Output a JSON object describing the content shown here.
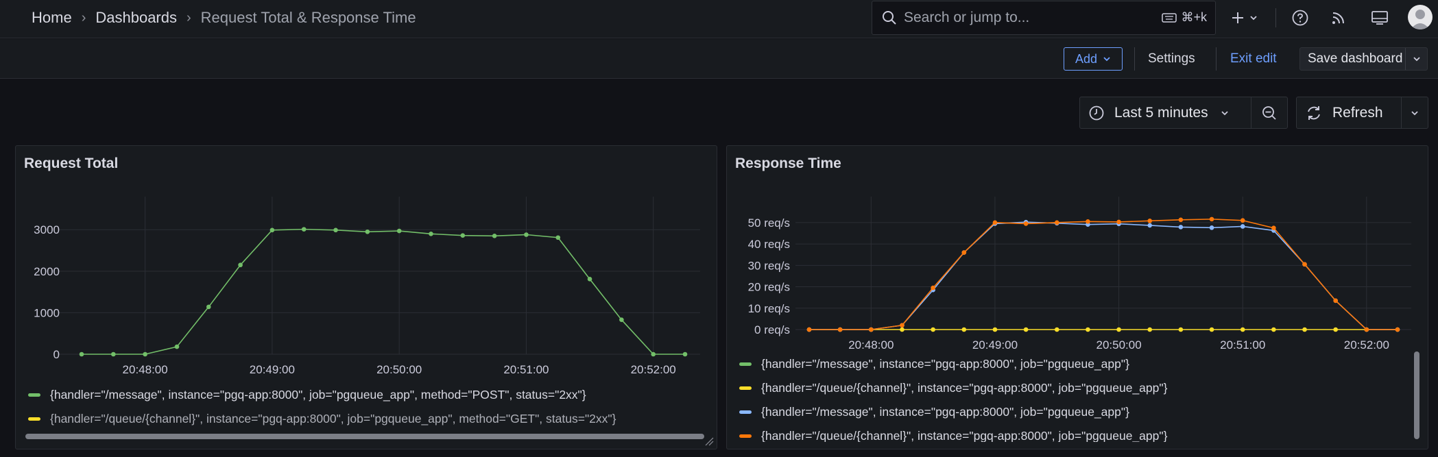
{
  "breadcrumb": [
    "Home",
    "Dashboards",
    "Request Total & Response Time"
  ],
  "breadcrumb_sep": "›",
  "search": {
    "placeholder": "Search or jump to...",
    "shortcut": "⌘+k"
  },
  "toolbar": {
    "add_label": "Add",
    "settings_label": "Settings",
    "exit_label": "Exit edit",
    "save_label": "Save dashboard"
  },
  "time_picker": {
    "range": "Last 5 minutes",
    "refresh_label": "Refresh"
  },
  "colors": {
    "green": "#73bf69",
    "yellow": "#fade2a",
    "blue": "#8ab8ff",
    "orange": "#ff780a",
    "accent": "#6e9fff"
  },
  "panels": {
    "request_total": {
      "title": "Request Total",
      "legend": [
        {
          "label": "{handler=\"/message\", instance=\"pgq-app:8000\", job=\"pgqueue_app\", method=\"POST\", status=\"2xx\"}",
          "color": "#73bf69"
        },
        {
          "label": "{handler=\"/queue/{channel}\", instance=\"pgq-app:8000\", job=\"pgqueue_app\", method=\"GET\", status=\"2xx\"}",
          "color": "#fade2a"
        }
      ]
    },
    "response_time": {
      "title": "Response Time",
      "legend": [
        {
          "label": "{handler=\"/message\", instance=\"pgq-app:8000\", job=\"pgqueue_app\"}",
          "color": "#73bf69"
        },
        {
          "label": "{handler=\"/queue/{channel}\", instance=\"pgq-app:8000\", job=\"pgqueue_app\"}",
          "color": "#fade2a"
        },
        {
          "label": "{handler=\"/message\", instance=\"pgq-app:8000\", job=\"pgqueue_app\"}",
          "color": "#8ab8ff"
        },
        {
          "label": "{handler=\"/queue/{channel}\", instance=\"pgq-app:8000\", job=\"pgqueue_app\"}",
          "color": "#ff780a"
        }
      ]
    }
  },
  "chart_data": [
    {
      "type": "line",
      "title": "Request Total",
      "x": [
        "20:47:30",
        "20:47:45",
        "20:48:00",
        "20:48:15",
        "20:48:30",
        "20:48:45",
        "20:49:00",
        "20:49:15",
        "20:49:30",
        "20:49:45",
        "20:50:00",
        "20:50:15",
        "20:50:30",
        "20:50:45",
        "20:51:00",
        "20:51:15",
        "20:51:30",
        "20:51:45",
        "20:52:00",
        "20:52:15"
      ],
      "xticks": [
        "20:48:00",
        "20:49:00",
        "20:50:00",
        "20:51:00",
        "20:52:00"
      ],
      "yticks": [
        "0",
        "1000",
        "2000",
        "3000"
      ],
      "ylim": [
        0,
        3400
      ],
      "grid": true,
      "series": [
        {
          "name": "{handler=\"/message\", instance=\"pgq-app:8000\", job=\"pgqueue_app\", method=\"POST\", status=\"2xx\"}",
          "color": "#73bf69",
          "values": [
            0,
            0,
            0,
            180,
            1140,
            2150,
            2990,
            3010,
            2990,
            2950,
            2970,
            2900,
            2860,
            2850,
            2880,
            2810,
            1810,
            830,
            0,
            0
          ]
        }
      ]
    },
    {
      "type": "line",
      "title": "Response Time",
      "x": [
        "20:47:30",
        "20:47:45",
        "20:48:00",
        "20:48:15",
        "20:48:30",
        "20:48:45",
        "20:49:00",
        "20:49:15",
        "20:49:30",
        "20:49:45",
        "20:50:00",
        "20:50:15",
        "20:50:30",
        "20:50:45",
        "20:51:00",
        "20:51:15",
        "20:51:30",
        "20:51:45",
        "20:52:00",
        "20:52:15"
      ],
      "xticks": [
        "20:48:00",
        "20:49:00",
        "20:50:00",
        "20:51:00",
        "20:52:00"
      ],
      "yticks": [
        "0 req/s",
        "10 req/s",
        "20 req/s",
        "30 req/s",
        "40 req/s",
        "50 req/s"
      ],
      "ylim": [
        0,
        57
      ],
      "grid": true,
      "series": [
        {
          "name": "{handler=\"/queue/{channel}\", instance=\"pgq-app:8000\", job=\"pgqueue_app\"}",
          "color": "#fade2a",
          "values": [
            0,
            0,
            0,
            0,
            0,
            0,
            0,
            0,
            0,
            0,
            0,
            0,
            0,
            0,
            0,
            0,
            0,
            0,
            0,
            0
          ]
        },
        {
          "name": "{handler=\"/message\", instance=\"pgq-app:8000\", job=\"pgqueue_app\"}",
          "color": "#8ab8ff",
          "values": [
            0,
            0,
            0,
            2,
            18.5,
            36,
            49.5,
            50.2,
            49.7,
            49.1,
            49.4,
            48.7,
            47.9,
            47.6,
            48.2,
            46.3,
            30.5,
            13.5,
            0,
            0
          ]
        },
        {
          "name": "{handler=\"/queue/{channel}\", instance=\"pgq-app:8000\", job=\"pgqueue_app\"}",
          "color": "#ff780a",
          "values": [
            0,
            0,
            0,
            2,
            19.5,
            36,
            50,
            49.5,
            50,
            50.5,
            50.3,
            50.8,
            51.3,
            51.6,
            51,
            47.5,
            30.5,
            13.5,
            0,
            0
          ]
        }
      ]
    }
  ]
}
